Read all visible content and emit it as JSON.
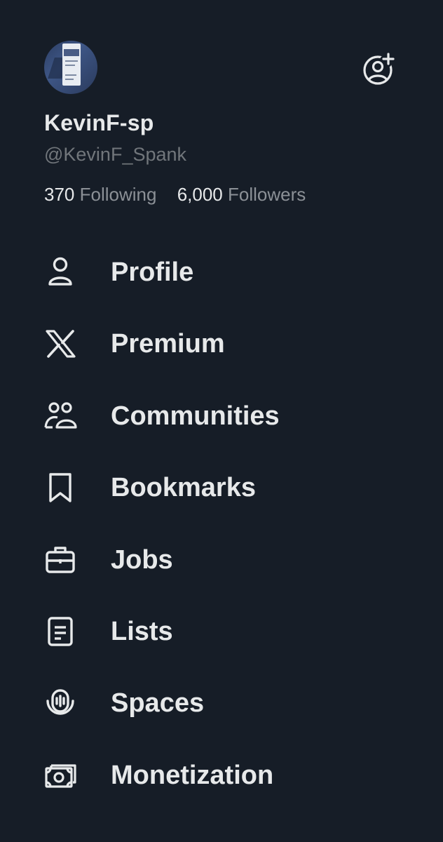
{
  "profile": {
    "display_name": "KevinF-sp",
    "handle": "@KevinF_Spank",
    "avatar_icon": "avatar-image",
    "add_account_icon": "add-account-icon"
  },
  "stats": {
    "following_count": "370",
    "following_label": "Following",
    "followers_count": "6,000",
    "followers_label": "Followers"
  },
  "menu": {
    "items": [
      {
        "label": "Profile",
        "icon": "person-icon"
      },
      {
        "label": "Premium",
        "icon": "x-logo-icon"
      },
      {
        "label": "Communities",
        "icon": "communities-icon"
      },
      {
        "label": "Bookmarks",
        "icon": "bookmark-icon"
      },
      {
        "label": "Jobs",
        "icon": "briefcase-icon"
      },
      {
        "label": "Lists",
        "icon": "list-icon"
      },
      {
        "label": "Spaces",
        "icon": "spaces-icon"
      },
      {
        "label": "Monetization",
        "icon": "monetization-icon"
      }
    ]
  },
  "colors": {
    "background": "#161d27",
    "primary_text": "#e7e9ea",
    "secondary_text": "#71767b"
  }
}
